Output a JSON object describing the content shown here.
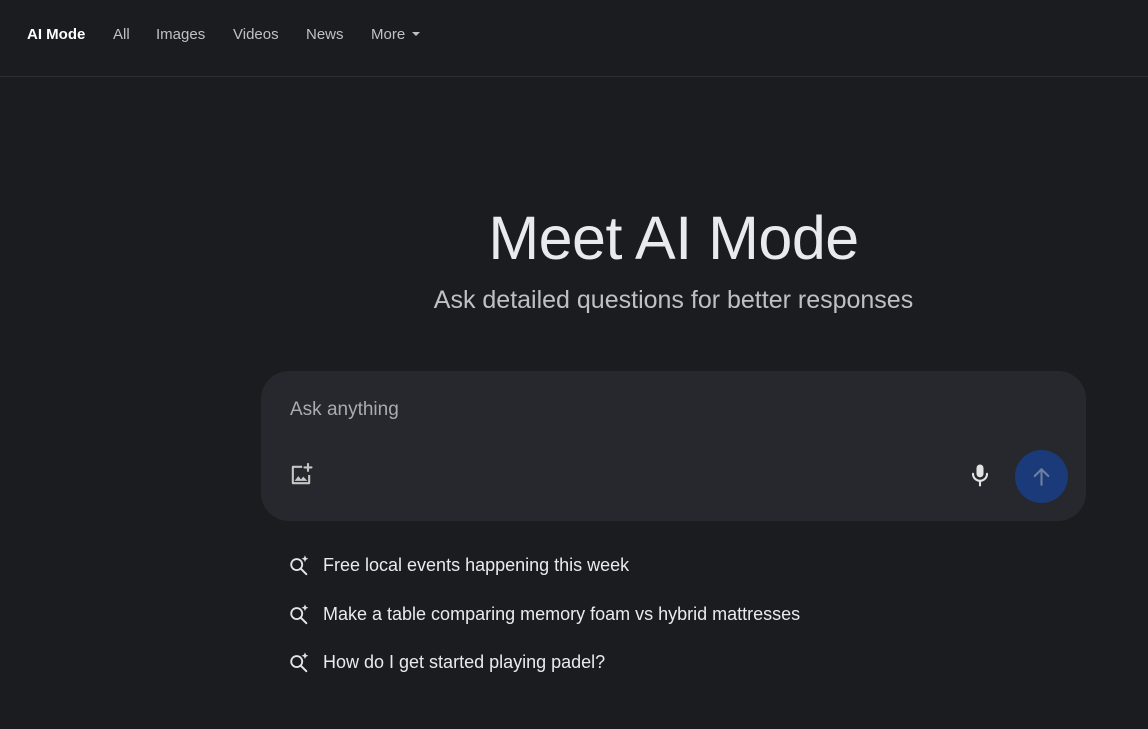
{
  "nav": {
    "tabs": [
      {
        "label": "AI Mode",
        "active": true
      },
      {
        "label": "All"
      },
      {
        "label": "Images"
      },
      {
        "label": "Videos"
      },
      {
        "label": "News"
      },
      {
        "label": "More"
      }
    ]
  },
  "hero": {
    "title": "Meet AI Mode",
    "subtitle": "Ask detailed questions for better responses"
  },
  "search": {
    "placeholder": "Ask anything",
    "value": "",
    "icons": {
      "upload": "add-image-icon",
      "mic": "microphone-icon",
      "send": "arrow-up-icon"
    }
  },
  "suggestions": [
    {
      "label": "Free local events happening this week",
      "icon": "search-sparkle-icon"
    },
    {
      "label": "Make a table comparing memory foam vs hybrid mattresses",
      "icon": "search-sparkle-icon"
    },
    {
      "label": "How do I get started playing padel?",
      "icon": "search-sparkle-icon"
    }
  ],
  "colors": {
    "background": "#1b1c20",
    "searchbox": "#27282d",
    "send_button": "#1a3a7a",
    "text_primary": "#e8eaed",
    "text_secondary": "#bdc1c6"
  }
}
